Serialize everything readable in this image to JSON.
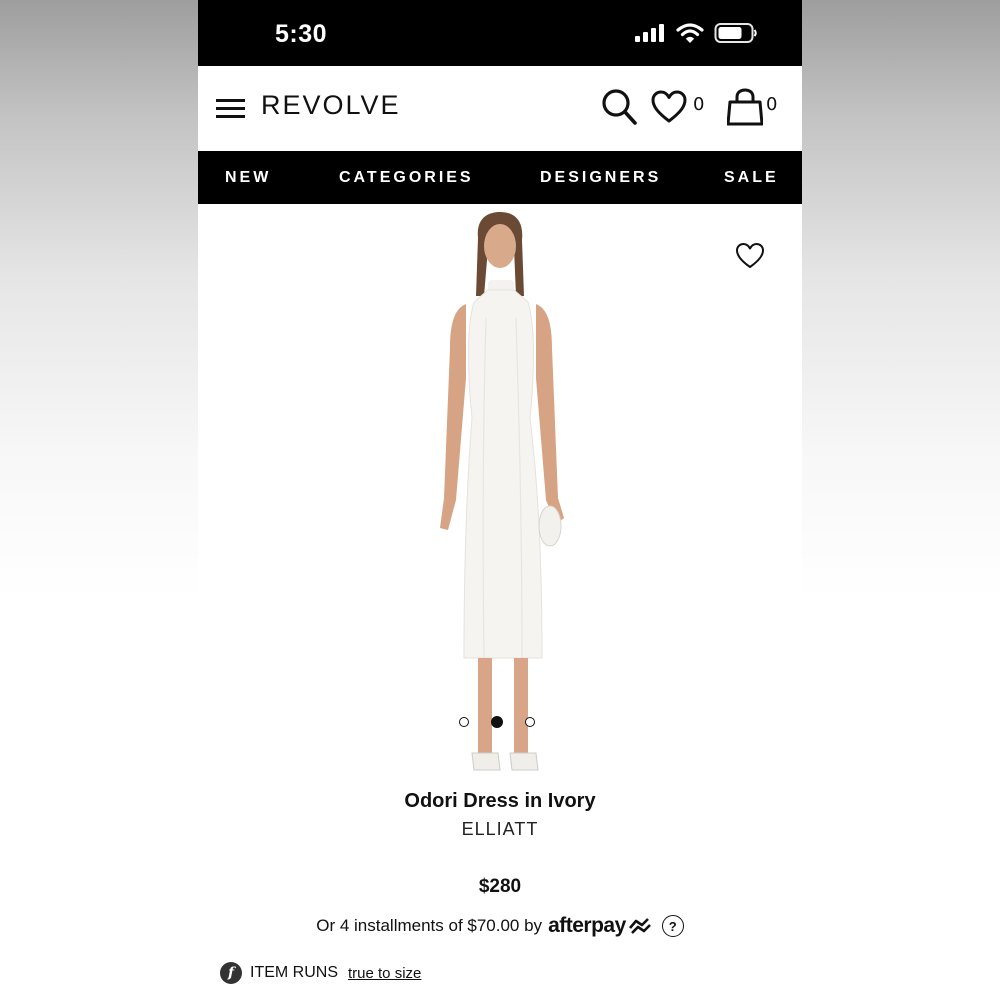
{
  "status_bar": {
    "time": "5:30"
  },
  "header": {
    "logo": "REVOLVE",
    "wishlist_count": "0",
    "bag_count": "0",
    "icons": [
      "menu-icon",
      "search-icon",
      "heart-icon",
      "bag-icon"
    ]
  },
  "nav": {
    "items": [
      {
        "label": "NEW"
      },
      {
        "label": "CATEGORIES"
      },
      {
        "label": "DESIGNERS"
      },
      {
        "label": "SALE"
      }
    ]
  },
  "product": {
    "name": "Odori Dress in Ivory",
    "brand": "ELLIATT",
    "price": "$280",
    "image_count": 3,
    "active_image_index": 1,
    "installments": {
      "text": "Or 4 installments of $70.00 by",
      "provider": "afterpay",
      "help": "?"
    },
    "fit": {
      "icon_letter": "f",
      "label": "ITEM RUNS",
      "value": "true to size"
    }
  },
  "colors": {
    "bar_black": "#000000",
    "text_dark": "#111111",
    "background": "#ffffff"
  }
}
